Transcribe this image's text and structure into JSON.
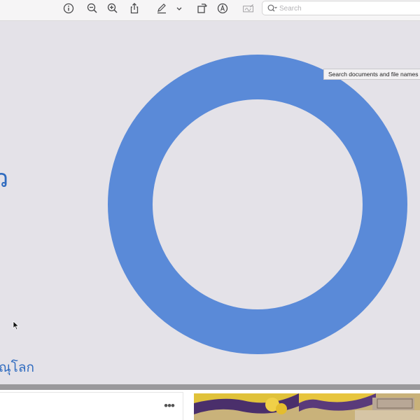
{
  "toolbar": {
    "search": {
      "placeholder": "Search",
      "value": ""
    },
    "buttons": {
      "info": "info-icon",
      "zoom_out": "zoom-out-icon",
      "zoom_in": "zoom-in-icon",
      "share": "share-icon",
      "markup": "pen-icon",
      "markup_menu": "chevron-down-icon",
      "rotate": "rotate-icon",
      "annotate": "annotate-icon",
      "sign": "signature-icon"
    }
  },
  "document": {
    "tooltip": "Search documents and file names",
    "thai_fragment": "ณุโลก",
    "left_glyph": "ว",
    "ring_color": "#5a8ad8",
    "background_color": "#e4e2e8",
    "text_color": "#2f6bbf"
  },
  "bottom": {
    "more_label": "•••"
  }
}
